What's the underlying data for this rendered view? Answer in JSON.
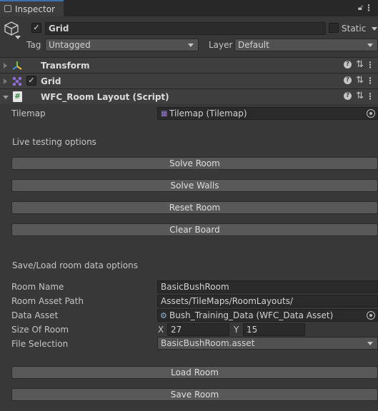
{
  "tab": {
    "title": "Inspector"
  },
  "header": {
    "name": "Grid",
    "static_label": "Static",
    "tag_label": "Tag",
    "tag_value": "Untagged",
    "layer_label": "Layer",
    "layer_value": "Default"
  },
  "components": [
    {
      "name": "Transform"
    },
    {
      "name": "Grid"
    },
    {
      "name": "WFC_Room Layout (Script)"
    }
  ],
  "script": {
    "tilemap_label": "Tilemap",
    "tilemap_value": "Tilemap (Tilemap)",
    "live_section": "Live testing options",
    "buttons": [
      "Solve Room",
      "Solve Walls",
      "Reset Room",
      "Clear Board"
    ],
    "save_section": "Save/Load room data options",
    "room_name_label": "Room Name",
    "room_name_value": "BasicBushRoom",
    "room_path_label": "Room Asset Path",
    "room_path_value": "Assets/TileMaps/RoomLayouts/",
    "data_asset_label": "Data Asset",
    "data_asset_value": "Bush_Training_Data (WFC_Data Asset)",
    "size_label": "Size Of Room",
    "size_x_label": "X",
    "size_x_value": "27",
    "size_y_label": "Y",
    "size_y_value": "15",
    "file_label": "File Selection",
    "file_value": "BasicBushRoom.asset",
    "load_button": "Load Room",
    "save_button": "Save Room"
  },
  "colors": {
    "background": "#383838",
    "field": "#2a2a2a",
    "button": "#585858",
    "tab_accent": "#3a72b0"
  }
}
